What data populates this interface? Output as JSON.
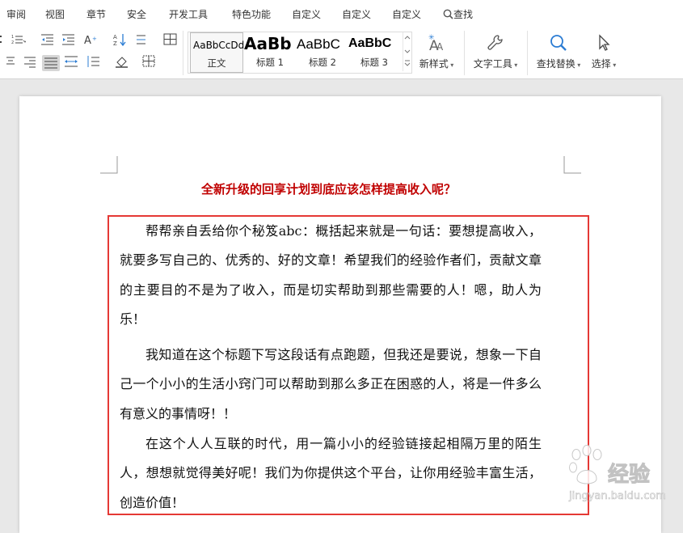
{
  "menu": {
    "items": [
      "审阅",
      "视图",
      "章节",
      "安全",
      "开发工具",
      "特色功能",
      "自定义",
      "自定义",
      "自定义",
      "查找"
    ]
  },
  "ribbon": {
    "styles": [
      {
        "preview": "AaBbCcDd",
        "label": "正文"
      },
      {
        "preview": "AaBb",
        "label": "标题 1"
      },
      {
        "preview": "AaBbC",
        "label": "标题 2"
      },
      {
        "preview": "AaBbC",
        "label": "标题 3"
      }
    ],
    "new_style": "新样式",
    "text_tools": "文字工具",
    "find_replace": "查找替换",
    "select": "选择"
  },
  "document": {
    "title": "全新升级的回享计划到底应该怎样提高收入呢？",
    "paragraphs": [
      "帮帮亲自丢给你个秘笈abc：概括起来就是一句话：要想提高收入，就要多写自己的、优秀的、好的文章！希望我们的经验作者们，贡献文章的主要目的不是为了收入，而是切实帮助到那些需要的人！嗯，助人为乐！",
      "我知道在这个标题下写这段话有点跑题，但我还是要说，想象一下自己一个小小的生活小窍门可以帮助到那么多正在困惑的人，将是一件多么有意义的事情呀！！",
      "在这个人人互联的时代，用一篇小小的经验链接起相隔万里的陌生人，想想就觉得美好呢！我们为你提供这个平台，让你用经验丰富生活，创造价值！"
    ]
  },
  "watermark": {
    "brand": "经验",
    "url": "jingyan.baidu.com"
  },
  "colors": {
    "title": "#c00000",
    "highlight_border": "#e53935",
    "accent_blue": "#2b7cd3"
  }
}
